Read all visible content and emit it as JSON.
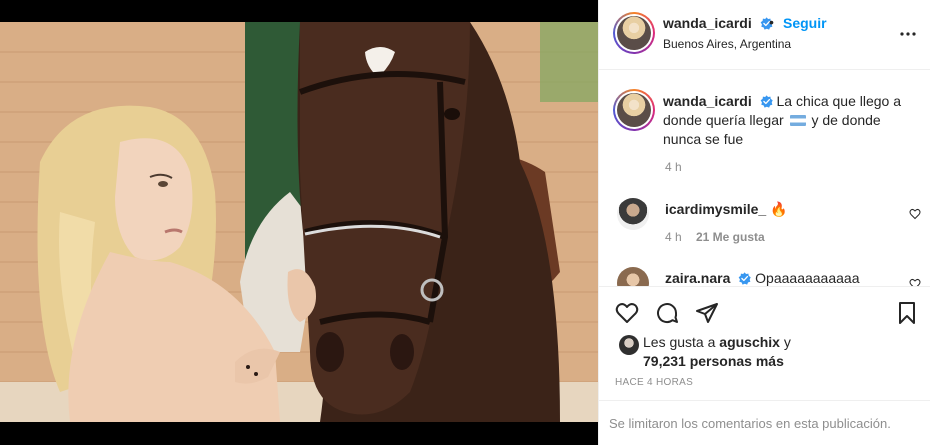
{
  "post": {
    "username": "wanda_icardi",
    "follow_label": "Seguir",
    "separator": "•",
    "location": "Buenos Aires, Argentina",
    "more_icon": "more-options-icon",
    "image_alt": "photo-woman-with-horse"
  },
  "caption": {
    "username": "wanda_icardi",
    "text_before_flag": "La chica que llego a donde quería llegar",
    "flag": "argentina-flag-emoji",
    "text_after_flag": "y de donde nunca se fue",
    "time": "4 h"
  },
  "comments": [
    {
      "username": "icardimysmile_",
      "text": "🔥",
      "time": "4 h",
      "likes": "21 Me gusta"
    },
    {
      "username": "zaira.nara",
      "text": "Opaaaaaaaaaaa",
      "verified": true
    }
  ],
  "actions": {
    "icons": [
      "heart-icon",
      "comment-icon",
      "share-icon",
      "bookmark-icon"
    ]
  },
  "likes": {
    "prefix": "Les gusta a",
    "user": "aguschix",
    "conjunction": "y",
    "count": "79,231 personas más"
  },
  "timestamp": "HACE 4 HORAS",
  "comments_limited": "Se limitaron los comentarios en esta publicación.",
  "colors": {
    "accent": "#0095f6",
    "secondary_text": "#8e8e8e",
    "verified": "#3897f0"
  }
}
